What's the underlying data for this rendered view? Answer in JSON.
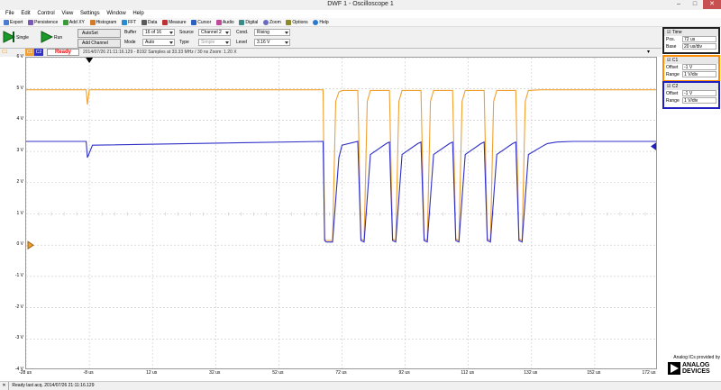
{
  "window": {
    "title": "DWF 1 - Oscilloscope 1",
    "minimize": "–",
    "maximize": "□",
    "close": "✕"
  },
  "menu": [
    "File",
    "Edit",
    "Control",
    "View",
    "Settings",
    "Window",
    "Help"
  ],
  "toolbar": [
    "Export",
    "Persistence",
    "Add XY",
    "Histogram",
    "FFT",
    "Data",
    "Measure",
    "Cursor",
    "Audio",
    "Digital",
    "Zoom",
    "Options",
    "Help"
  ],
  "toolbar_icons": [
    "export-icon",
    "persistence-icon",
    "add-xy-icon",
    "histogram-icon",
    "fft-icon",
    "data-icon",
    "measure-icon",
    "cursor-icon",
    "audio-icon",
    "digital-icon",
    "zoom-icon",
    "options-icon",
    "help-icon"
  ],
  "controls": {
    "single_label": "Single",
    "run_label": "Run",
    "autoset_label": "AutoSet",
    "add_channel_label": "Add Channel",
    "buffer_label": "Buffer",
    "buffer_value": "16 of 16",
    "mode_label": "Mode",
    "mode_value": "Auto",
    "source_label": "Source",
    "source_value": "Channel 2",
    "type_label": "Type",
    "type_value": "Simple",
    "cond_label": "Cond.",
    "cond_value": "Rising",
    "level_label": "Level",
    "level_value": "3.16 V"
  },
  "status": {
    "channel_tags": [
      "C1",
      "C2"
    ],
    "state": "Ready",
    "info": "2014/07/26  21:11:16.129 - 8192 Samples at 33.33 MHz / 30 ns  Zoom: 1.20 X",
    "bottom_c1": "C1",
    "bottom": "Ready last acq.  2014/07/26  21:11:16.129"
  },
  "side": {
    "time": {
      "title": "Time",
      "pos_label": "Pos.",
      "pos_value": "72 us",
      "base_label": "Base",
      "base_value": "20 us/div"
    },
    "c1": {
      "title": "C1",
      "offset_label": "Offset",
      "offset_value": "-1 V",
      "range_label": "Range",
      "range_value": "1 V/div"
    },
    "c2": {
      "title": "C2",
      "offset_label": "Offset",
      "offset_value": "-1 V",
      "range_label": "Range",
      "range_value": "1 V/div"
    }
  },
  "logo": {
    "line1": "Analog ICs provided by",
    "line2": "ANALOG",
    "line3": "DEVICES"
  },
  "colors": {
    "c1": "#f0a030",
    "c2": "#3030c8",
    "accent": "#ff8c00",
    "ready": "#ff0000"
  },
  "chart_data": {
    "type": "line",
    "title": "",
    "xlabel": "",
    "ylabel": "",
    "x_ticks": [
      "-28 us",
      "-8 us",
      "12 us",
      "32 us",
      "52 us",
      "72 us",
      "92 us",
      "112 us",
      "132 us",
      "152 us",
      "172 us"
    ],
    "y_ticks": [
      "6 V",
      "5 V",
      "4 V",
      "3 V",
      "2 V",
      "1 V",
      "0 V",
      "-1 V",
      "-2 V",
      "-3 V",
      "-4 V"
    ],
    "xlim": [
      -28,
      172
    ],
    "ylim": [
      -4,
      6
    ],
    "grid": true,
    "series": [
      {
        "name": "C1",
        "x": [
          -28,
          -9,
          -8.6,
          -8,
          66,
          66.5,
          67,
          69,
          70,
          71,
          72,
          77,
          78,
          79,
          80,
          81,
          87,
          88,
          89,
          90,
          91,
          97,
          98,
          99,
          100,
          101,
          107,
          108,
          109,
          110,
          111,
          117,
          118,
          119,
          120,
          121,
          127,
          128,
          129,
          130,
          131,
          135,
          136,
          172
        ],
        "y": [
          4.97,
          4.97,
          4.5,
          4.97,
          4.97,
          0.2,
          0.15,
          0.15,
          4.6,
          4.9,
          4.95,
          4.95,
          0.2,
          0.15,
          4.6,
          4.95,
          4.95,
          0.2,
          0.15,
          4.6,
          4.95,
          4.95,
          0.2,
          0.15,
          4.6,
          4.95,
          4.95,
          0.2,
          0.15,
          4.6,
          4.95,
          4.95,
          0.2,
          0.15,
          4.6,
          4.95,
          4.95,
          0.2,
          0.15,
          4.6,
          4.95,
          4.97,
          4.97,
          4.97
        ]
      },
      {
        "name": "C2",
        "x": [
          -28,
          -9,
          -8.6,
          -7,
          66,
          66.5,
          67,
          69,
          71,
          72,
          77,
          78,
          79,
          81,
          86,
          87,
          88,
          89,
          91,
          96,
          97,
          98,
          99,
          101,
          106,
          107,
          108,
          109,
          111,
          116,
          117,
          118,
          119,
          121,
          126,
          127,
          128,
          129,
          131,
          136,
          137,
          140,
          145,
          172
        ],
        "y": [
          3.32,
          3.32,
          2.8,
          3.2,
          3.32,
          0.15,
          0.1,
          0.1,
          2.8,
          3.2,
          3.32,
          0.15,
          0.1,
          2.9,
          3.25,
          3.3,
          0.15,
          0.1,
          2.9,
          3.25,
          3.3,
          0.15,
          0.1,
          2.9,
          3.25,
          3.3,
          0.15,
          0.1,
          2.9,
          3.25,
          3.3,
          0.15,
          0.1,
          2.9,
          3.25,
          3.3,
          0.15,
          0.1,
          2.9,
          3.2,
          3.25,
          3.3,
          3.32,
          3.32
        ]
      }
    ]
  }
}
